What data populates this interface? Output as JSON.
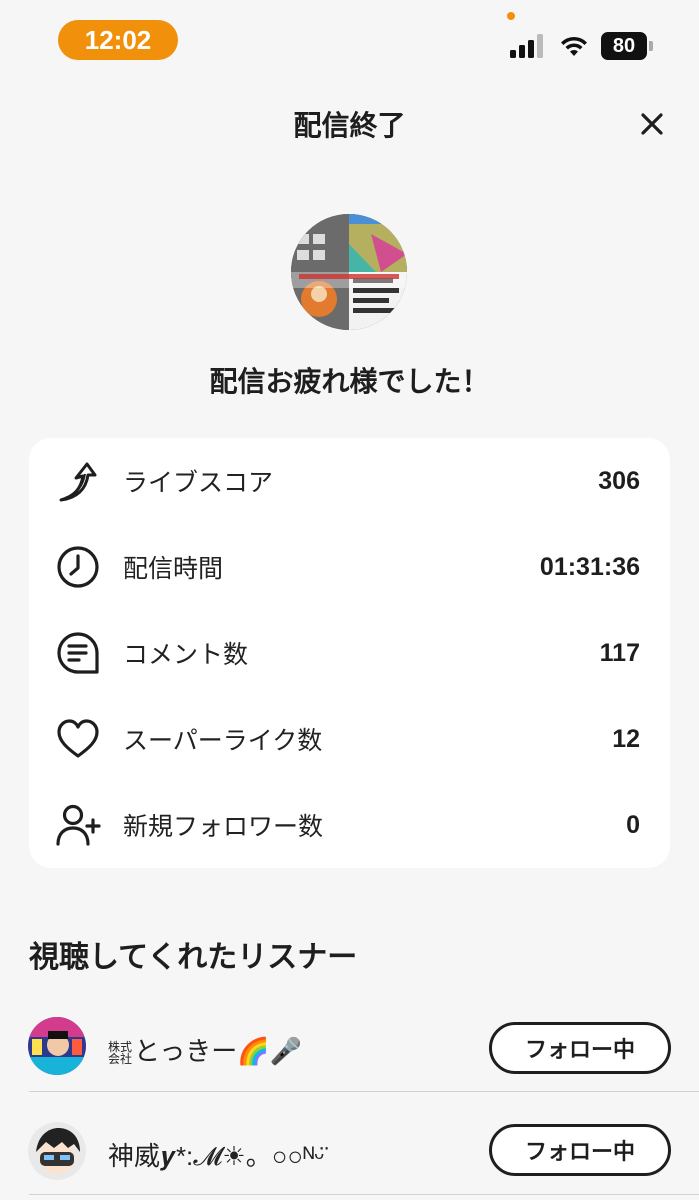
{
  "status_bar": {
    "time": "12:02",
    "battery": "80",
    "signal_icon": "cellular-signal-icon",
    "wifi_icon": "wifi-icon",
    "accent_color": "#f0900b"
  },
  "header": {
    "title": "配信終了",
    "close_icon": "close-icon"
  },
  "summary": {
    "message": "配信お疲れ様でした！"
  },
  "stats": [
    {
      "label": "ライブスコア",
      "value": "306",
      "icon": "live-score-icon"
    },
    {
      "label": "配信時間",
      "value": "01:31:36",
      "icon": "clock-icon"
    },
    {
      "label": "コメント数",
      "value": "117",
      "icon": "comment-icon"
    },
    {
      "label": "スーパーライク数",
      "value": "12",
      "icon": "heart-icon"
    },
    {
      "label": "新規フォロワー数",
      "value": "0",
      "icon": "add-user-icon"
    }
  ],
  "listeners_section": {
    "title": "視聴してくれたリスナー",
    "items": [
      {
        "name_prefix_top": "株式",
        "name_prefix_bottom": "会社",
        "name": "とっきー🌈🎤",
        "button": "フォロー中"
      },
      {
        "name": "神威𝒚*:𝓜☀。○○ᴺᵕ̈",
        "button": "フォロー中"
      }
    ]
  }
}
